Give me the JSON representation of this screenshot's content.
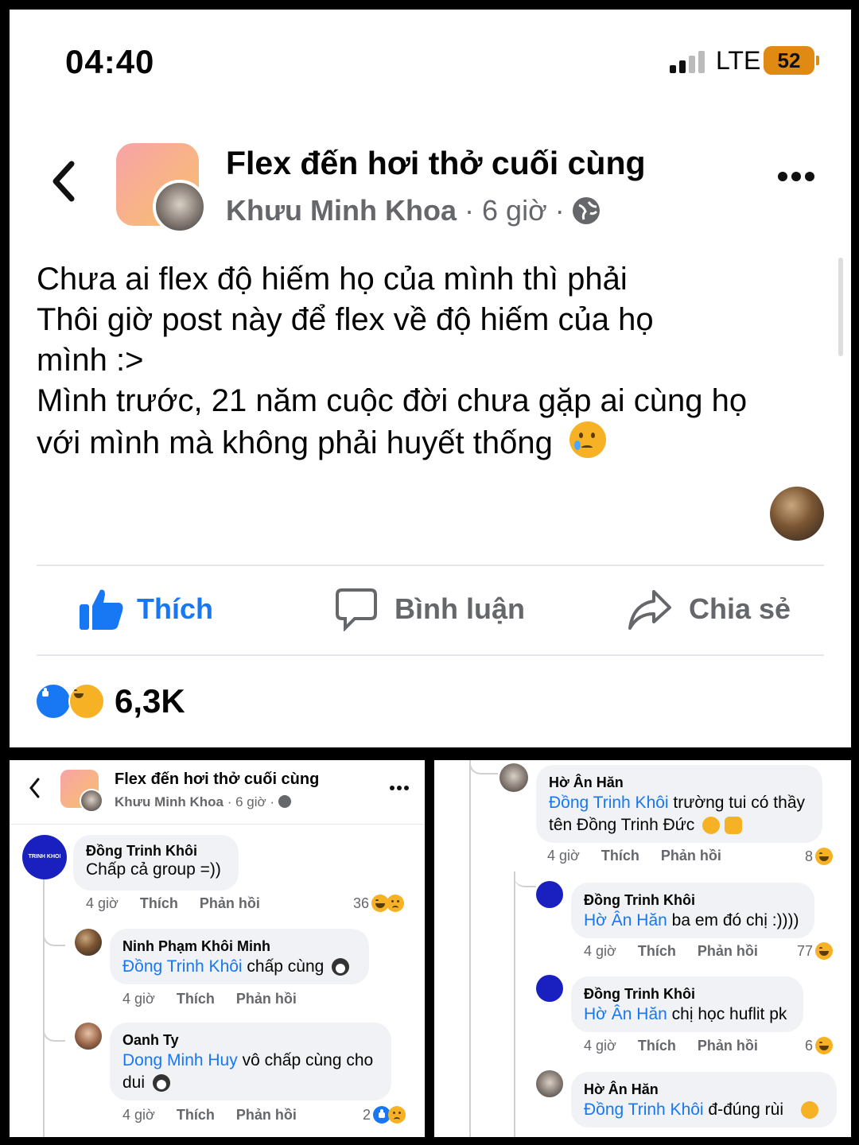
{
  "status_bar": {
    "time": "04:40",
    "network": "LTE",
    "battery": "52"
  },
  "header": {
    "group_name": "Flex đến hơi thở cuối cùng",
    "author": "Khưu Minh Khoa",
    "time": "6 giờ"
  },
  "post": {
    "lines": [
      "Chưa ai flex độ hiếm họ của mình thì phải",
      "Thôi giờ post này để flex về độ hiếm của họ",
      "mình :>",
      "Mình trước, 21 năm cuộc đời chưa gặp ai cùng họ",
      "với mình mà không phải huyết thống"
    ]
  },
  "actions": {
    "like": "Thích",
    "comment": "Bình luận",
    "share": "Chia sẻ"
  },
  "reactions": {
    "count": "6,3K"
  },
  "left_panel": {
    "header": {
      "group_name": "Flex đến hơi thở cuối cùng",
      "author": "Khưu Minh Khoa",
      "time": "6 giờ"
    },
    "logo_text": "TRINH KHOI",
    "comments": [
      {
        "name": "Đồng Trinh Khôi",
        "text": "Chấp cả group =))",
        "time": "4 giờ",
        "like": "Thích",
        "reply": "Phản hồi",
        "reactions": "36"
      },
      {
        "name": "Ninh Phạm Khôi Minh",
        "mention": "Đồng Trinh Khôi",
        "text": " chấp cùng",
        "time": "4 giờ",
        "like": "Thích",
        "reply": "Phản hồi"
      },
      {
        "name": "Oanh Ty",
        "mention": "Dong Minh Huy",
        "text": " vô chấp cùng cho",
        "text2": "dui",
        "time": "4 giờ",
        "like": "Thích",
        "reply": "Phản hồi",
        "reactions": "2"
      }
    ]
  },
  "right_panel": {
    "comments": [
      {
        "name": "Hờ Ân Hăn",
        "mention": "Đồng Trinh Khôi",
        "text": " trường tui có thầy",
        "text2": "tên Đồng Trinh Đức",
        "time": "4 giờ",
        "like": "Thích",
        "reply": "Phản hồi",
        "reactions": "8"
      },
      {
        "name": "Đồng Trinh Khôi",
        "mention": "Hờ Ân Hăn",
        "text": " ba em đó chị :))))",
        "time": "4 giờ",
        "like": "Thích",
        "reply": "Phản hồi",
        "reactions": "77"
      },
      {
        "name": "Đồng Trinh Khôi",
        "mention": "Hờ Ân Hăn",
        "text": " chị học huflit pk",
        "time": "4 giờ",
        "like": "Thích",
        "reply": "Phản hồi",
        "reactions": "6"
      },
      {
        "name": "Hờ Ân Hăn",
        "mention": "Đồng Trinh Khôi",
        "text": " đ-đúng rùi"
      }
    ]
  },
  "colors": {
    "accent": "#1877f2",
    "meta": "#65676b",
    "bubble": "#f0f2f5",
    "haha": "#f7b125",
    "battery": "#e08a14"
  },
  "icons": [
    "back-icon",
    "more-icon",
    "globe-icon",
    "signal-icon",
    "battery-icon",
    "like-icon",
    "comment-icon",
    "share-icon",
    "like-reaction-icon",
    "haha-reaction-icon",
    "sad-reaction-icon",
    "crying-emoji",
    "penguin-emoji",
    "heart-hands-emoji",
    "pleading-emoji"
  ]
}
